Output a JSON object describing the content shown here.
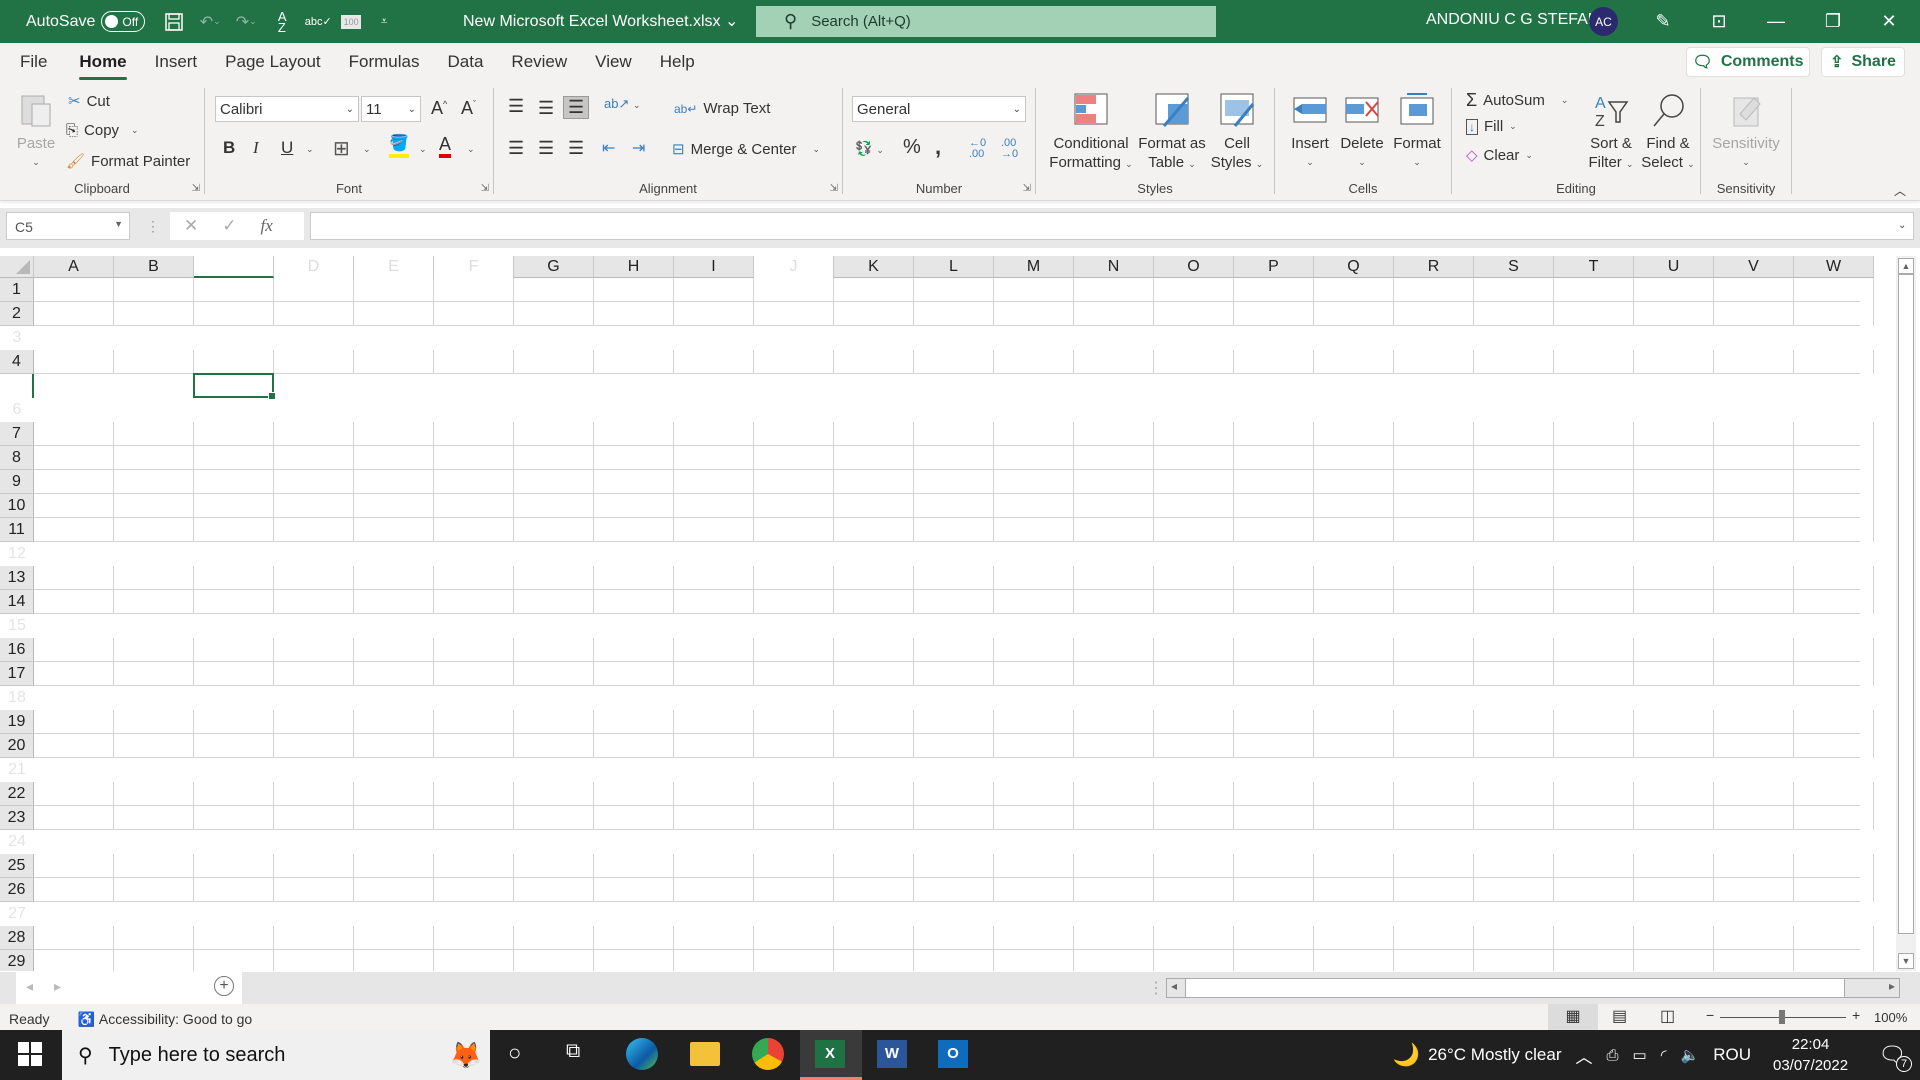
{
  "titlebar": {
    "autosave_label": "AutoSave",
    "autosave_state": "Off",
    "doc_title": "New Microsoft Excel Worksheet.xlsx",
    "search_placeholder": "Search (Alt+Q)",
    "user_name": "ANDONIU C G STEFAN",
    "user_initials": "AC",
    "accent": "#217346"
  },
  "menu": {
    "tabs": [
      "File",
      "Home",
      "Insert",
      "Page Layout",
      "Formulas",
      "Data",
      "Review",
      "View",
      "Help"
    ],
    "active": "Home",
    "comments_label": "Comments",
    "share_label": "Share"
  },
  "ribbon": {
    "clipboard": {
      "label": "Clipboard",
      "paste": "Paste",
      "cut": "Cut",
      "copy": "Copy",
      "format_painter": "Format Painter"
    },
    "font": {
      "label": "Font",
      "font_name": "Calibri",
      "font_size": "11",
      "bold": "B",
      "italic": "I",
      "underline": "U"
    },
    "alignment": {
      "label": "Alignment",
      "wrap_text": "Wrap Text",
      "merge_center": "Merge & Center"
    },
    "number": {
      "label": "Number",
      "format": "General"
    },
    "styles": {
      "label": "Styles",
      "conditional_1": "Conditional",
      "conditional_2": "Formatting",
      "format_table_1": "Format as",
      "format_table_2": "Table",
      "cell_styles_1": "Cell",
      "cell_styles_2": "Styles"
    },
    "cells": {
      "label": "Cells",
      "insert": "Insert",
      "delete": "Delete",
      "format": "Format"
    },
    "editing": {
      "label": "Editing",
      "autosum": "AutoSum",
      "fill": "Fill",
      "clear": "Clear",
      "sort_1": "Sort &",
      "sort_2": "Filter",
      "find_1": "Find &",
      "find_2": "Select"
    },
    "sensitivity": {
      "label": "Sensitivity",
      "button": "Sensitivity"
    }
  },
  "formula_bar": {
    "name_box": "C5",
    "formula": ""
  },
  "grid": {
    "columns": [
      "A",
      "B",
      "C",
      "D",
      "E",
      "F",
      "G",
      "H",
      "I",
      "J",
      "K",
      "L",
      "M",
      "N",
      "O",
      "P",
      "Q",
      "R",
      "S",
      "T",
      "U",
      "V",
      "W"
    ],
    "dim_columns": [
      "C",
      "D",
      "E",
      "F",
      "J"
    ],
    "rows": [
      1,
      2,
      3,
      4,
      5,
      6,
      7,
      8,
      9,
      10,
      11,
      12,
      13,
      14,
      15,
      16,
      17,
      18,
      19,
      20,
      21,
      22,
      23,
      24,
      25,
      26,
      27,
      28,
      29
    ],
    "dim_rows": [
      3,
      5,
      6,
      12,
      15,
      18,
      21,
      24,
      27
    ],
    "selected_cell": "C5"
  },
  "status": {
    "ready": "Ready",
    "accessibility": "Accessibility: Good to go",
    "zoom": "100%"
  },
  "taskbar": {
    "search_placeholder": "Type here to search",
    "weather": "26°C  Mostly clear",
    "language": "ROU",
    "time": "22:04",
    "date": "03/07/2022",
    "notifications": "7"
  }
}
